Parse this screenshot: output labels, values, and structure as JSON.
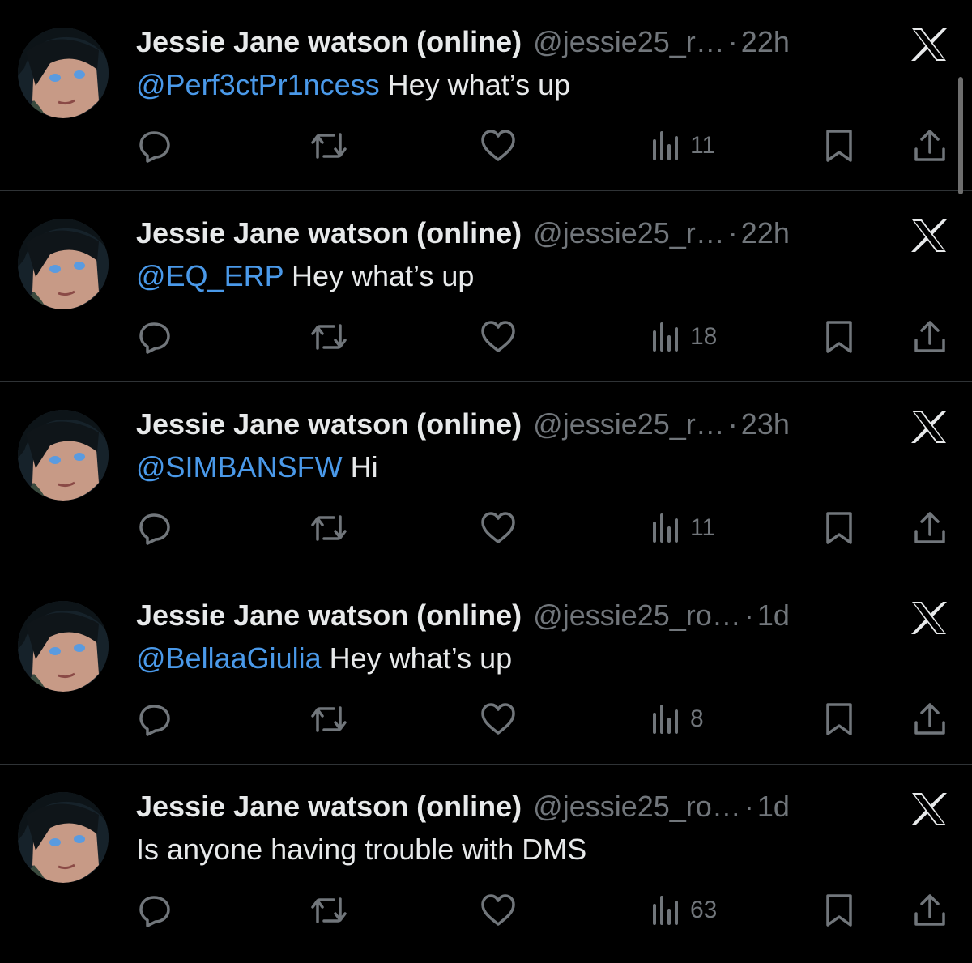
{
  "colors": {
    "background": "#000000",
    "name_text": "#e7e9ea",
    "secondary_text": "#71767b",
    "mention": "#4a99e9",
    "divider": "#2f3336"
  },
  "icons": {
    "reply": "reply-icon",
    "retweet": "retweet-icon",
    "like": "like-icon",
    "views": "views-icon",
    "bookmark": "bookmark-icon",
    "share": "share-icon",
    "brand": "x-logo-icon"
  },
  "tweets": [
    {
      "name": "Jessie Jane watson (online)",
      "handle": "@jessie25_r…",
      "sep": "·",
      "time": "22h",
      "mention": "@Perf3ctPr1ncess",
      "text": " Hey what’s up",
      "views": "11"
    },
    {
      "name": "Jessie Jane watson (online)",
      "handle": "@jessie25_r…",
      "sep": "·",
      "time": "22h",
      "mention": "@EQ_ERP",
      "text": " Hey what’s up",
      "views": "18"
    },
    {
      "name": "Jessie Jane watson (online)",
      "handle": "@jessie25_r…",
      "sep": "·",
      "time": "23h",
      "mention": "@SIMBANSFW",
      "text": " Hi",
      "views": "11"
    },
    {
      "name": "Jessie Jane watson (online)",
      "handle": "@jessie25_ro…",
      "sep": "·",
      "time": "1d",
      "mention": "@BellaaGiulia",
      "text": " Hey what’s up",
      "views": "8"
    },
    {
      "name": "Jessie Jane watson (online)",
      "handle": "@jessie25_ro…",
      "sep": "·",
      "time": "1d",
      "mention": "",
      "text": "Is anyone having trouble with DMS",
      "views": "63"
    }
  ]
}
